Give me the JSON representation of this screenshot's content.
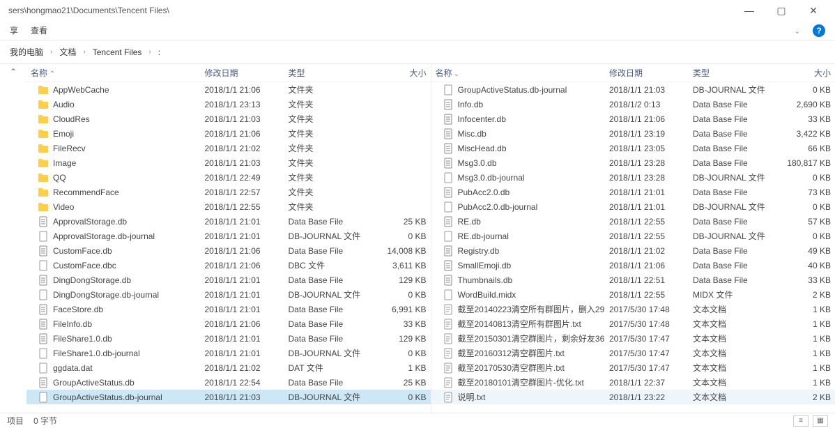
{
  "titlebar": {
    "path": "sers\\hongmao21\\Documents\\Tencent Files\\"
  },
  "menubar": {
    "share": "享",
    "view": "查看"
  },
  "breadcrumb": {
    "items": [
      "我的电脑",
      "文档",
      "Tencent Files",
      ":"
    ]
  },
  "headers": {
    "name": "名称",
    "date": "修改日期",
    "type": "类型",
    "size": "大小"
  },
  "left_pane": {
    "rows": [
      {
        "icon": "folder",
        "name": "AppWebCache",
        "date": "2018/1/1 21:06",
        "type": "文件夹",
        "size": ""
      },
      {
        "icon": "folder",
        "name": "Audio",
        "date": "2018/1/1 23:13",
        "type": "文件夹",
        "size": ""
      },
      {
        "icon": "folder",
        "name": "CloudRes",
        "date": "2018/1/1 21:03",
        "type": "文件夹",
        "size": ""
      },
      {
        "icon": "folder",
        "name": "Emoji",
        "date": "2018/1/1 21:06",
        "type": "文件夹",
        "size": ""
      },
      {
        "icon": "folder",
        "name": "FileRecv",
        "date": "2018/1/1 21:02",
        "type": "文件夹",
        "size": ""
      },
      {
        "icon": "folder",
        "name": "Image",
        "date": "2018/1/1 21:03",
        "type": "文件夹",
        "size": ""
      },
      {
        "icon": "folder",
        "name": "QQ",
        "date": "2018/1/1 22:49",
        "type": "文件夹",
        "size": ""
      },
      {
        "icon": "folder",
        "name": "RecommendFace",
        "date": "2018/1/1 22:57",
        "type": "文件夹",
        "size": ""
      },
      {
        "icon": "folder",
        "name": "Video",
        "date": "2018/1/1 22:55",
        "type": "文件夹",
        "size": ""
      },
      {
        "icon": "db",
        "name": "ApprovalStorage.db",
        "date": "2018/1/1 21:01",
        "type": "Data Base File",
        "size": "25 KB"
      },
      {
        "icon": "file",
        "name": "ApprovalStorage.db-journal",
        "date": "2018/1/1 21:01",
        "type": "DB-JOURNAL 文件",
        "size": "0 KB"
      },
      {
        "icon": "db",
        "name": "CustomFace.db",
        "date": "2018/1/1 21:06",
        "type": "Data Base File",
        "size": "14,008 KB"
      },
      {
        "icon": "file",
        "name": "CustomFace.dbc",
        "date": "2018/1/1 21:06",
        "type": "DBC 文件",
        "size": "3,611 KB"
      },
      {
        "icon": "db",
        "name": "DingDongStorage.db",
        "date": "2018/1/1 21:01",
        "type": "Data Base File",
        "size": "129 KB"
      },
      {
        "icon": "file",
        "name": "DingDongStorage.db-journal",
        "date": "2018/1/1 21:01",
        "type": "DB-JOURNAL 文件",
        "size": "0 KB"
      },
      {
        "icon": "db",
        "name": "FaceStore.db",
        "date": "2018/1/1 21:01",
        "type": "Data Base File",
        "size": "6,991 KB"
      },
      {
        "icon": "db",
        "name": "FileInfo.db",
        "date": "2018/1/1 21:06",
        "type": "Data Base File",
        "size": "33 KB"
      },
      {
        "icon": "db",
        "name": "FileShare1.0.db",
        "date": "2018/1/1 21:01",
        "type": "Data Base File",
        "size": "129 KB"
      },
      {
        "icon": "file",
        "name": "FileShare1.0.db-journal",
        "date": "2018/1/1 21:01",
        "type": "DB-JOURNAL 文件",
        "size": "0 KB"
      },
      {
        "icon": "file",
        "name": "ggdata.dat",
        "date": "2018/1/1 21:02",
        "type": "DAT 文件",
        "size": "1 KB"
      },
      {
        "icon": "db",
        "name": "GroupActiveStatus.db",
        "date": "2018/1/1 22:54",
        "type": "Data Base File",
        "size": "25 KB"
      },
      {
        "icon": "file",
        "name": "GroupActiveStatus.db-journal",
        "date": "2018/1/1 21:03",
        "type": "DB-JOURNAL 文件",
        "size": "0 KB",
        "selected": true
      }
    ]
  },
  "right_pane": {
    "rows": [
      {
        "icon": "file",
        "name": "GroupActiveStatus.db-journal",
        "date": "2018/1/1 21:03",
        "type": "DB-JOURNAL 文件",
        "size": "0 KB"
      },
      {
        "icon": "db",
        "name": "Info.db",
        "date": "2018/1/2 0:13",
        "type": "Data Base File",
        "size": "2,690 KB"
      },
      {
        "icon": "db",
        "name": "Infocenter.db",
        "date": "2018/1/1 21:06",
        "type": "Data Base File",
        "size": "33 KB"
      },
      {
        "icon": "db",
        "name": "Misc.db",
        "date": "2018/1/1 23:19",
        "type": "Data Base File",
        "size": "3,422 KB"
      },
      {
        "icon": "db",
        "name": "MiscHead.db",
        "date": "2018/1/1 23:05",
        "type": "Data Base File",
        "size": "66 KB"
      },
      {
        "icon": "db",
        "name": "Msg3.0.db",
        "date": "2018/1/1 23:28",
        "type": "Data Base File",
        "size": "180,817 KB"
      },
      {
        "icon": "file",
        "name": "Msg3.0.db-journal",
        "date": "2018/1/1 23:28",
        "type": "DB-JOURNAL 文件",
        "size": "0 KB"
      },
      {
        "icon": "db",
        "name": "PubAcc2.0.db",
        "date": "2018/1/1 21:01",
        "type": "Data Base File",
        "size": "73 KB"
      },
      {
        "icon": "file",
        "name": "PubAcc2.0.db-journal",
        "date": "2018/1/1 21:01",
        "type": "DB-JOURNAL 文件",
        "size": "0 KB"
      },
      {
        "icon": "db",
        "name": "RE.db",
        "date": "2018/1/1 22:55",
        "type": "Data Base File",
        "size": "57 KB"
      },
      {
        "icon": "file",
        "name": "RE.db-journal",
        "date": "2018/1/1 22:55",
        "type": "DB-JOURNAL 文件",
        "size": "0 KB"
      },
      {
        "icon": "db",
        "name": "Registry.db",
        "date": "2018/1/1 21:02",
        "type": "Data Base File",
        "size": "49 KB"
      },
      {
        "icon": "db",
        "name": "SmallEmoji.db",
        "date": "2018/1/1 21:06",
        "type": "Data Base File",
        "size": "40 KB"
      },
      {
        "icon": "db",
        "name": "Thumbnails.db",
        "date": "2018/1/1 22:51",
        "type": "Data Base File",
        "size": "33 KB"
      },
      {
        "icon": "file",
        "name": "WordBuild.midx",
        "date": "2018/1/1 22:55",
        "type": "MIDX 文件",
        "size": "2 KB"
      },
      {
        "icon": "txt",
        "name": "截至20140223清空所有群图片，删入29...",
        "date": "2017/5/30 17:48",
        "type": "文本文档",
        "size": "1 KB"
      },
      {
        "icon": "txt",
        "name": "截至20140813清空所有群图片.txt",
        "date": "2017/5/30 17:48",
        "type": "文本文档",
        "size": "1 KB"
      },
      {
        "icon": "txt",
        "name": "截至20150301清空群图片，剩余好友36...",
        "date": "2017/5/30 17:47",
        "type": "文本文档",
        "size": "1 KB"
      },
      {
        "icon": "txt",
        "name": "截至20160312清空群图片.txt",
        "date": "2017/5/30 17:47",
        "type": "文本文档",
        "size": "1 KB"
      },
      {
        "icon": "txt",
        "name": "截至20170530清空群图片.txt",
        "date": "2017/5/30 17:47",
        "type": "文本文档",
        "size": "1 KB"
      },
      {
        "icon": "txt",
        "name": "截至20180101清空群图片-优化.txt",
        "date": "2018/1/1 22:37",
        "type": "文本文档",
        "size": "1 KB"
      },
      {
        "icon": "txt",
        "name": "说明.txt",
        "date": "2018/1/1 23:22",
        "type": "文本文档",
        "size": "2 KB",
        "highlight": true
      }
    ]
  },
  "status": {
    "items": "项目",
    "bytes": "0 字节"
  }
}
